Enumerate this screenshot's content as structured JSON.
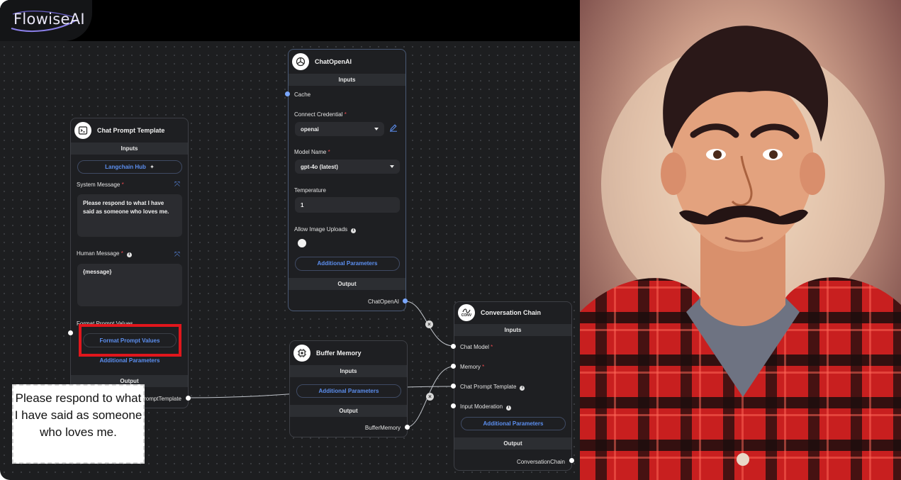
{
  "app": {
    "logo_text": "FlowiseAI"
  },
  "nodes": {
    "chat_prompt": {
      "title": "Chat Prompt Template",
      "inputs_label": "Inputs",
      "hub_button": "Langchain Hub",
      "system_message_label": "System Message",
      "system_message_value": "Please respond to what I have said as someone who loves me.",
      "human_message_label": "Human Message",
      "human_message_value": "{message}",
      "format_label": "Format Prompt Values",
      "format_button": "Format Prompt Values",
      "additional_params": "Additional Parameters",
      "output_label": "Output",
      "output_port": "ChatPromptTemplate"
    },
    "chat_openai": {
      "title": "ChatOpenAI",
      "inputs_label": "Inputs",
      "cache_label": "Cache",
      "credential_label": "Connect Credential",
      "credential_value": "openai",
      "model_label": "Model Name",
      "model_value": "gpt-4o (latest)",
      "temperature_label": "Temperature",
      "temperature_value": "1",
      "image_uploads_label": "Allow Image Uploads",
      "additional_params": "Additional Parameters",
      "output_label": "Output",
      "output_port": "ChatOpenAI"
    },
    "buffer_memory": {
      "title": "Buffer Memory",
      "inputs_label": "Inputs",
      "additional_params": "Additional Parameters",
      "output_label": "Output",
      "output_port": "BufferMemory"
    },
    "conversation_chain": {
      "title": "Conversation Chain",
      "icon_text": "CONV",
      "inputs_label": "Inputs",
      "chat_model_label": "Chat Model",
      "memory_label": "Memory",
      "prompt_label": "Chat Prompt Template",
      "moderation_label": "Input Moderation",
      "additional_params": "Additional Parameters",
      "output_label": "Output",
      "output_port": "ConversationChain"
    }
  },
  "callout": {
    "text": "Please respond to what I have said as someone who loves me."
  },
  "colors": {
    "canvas": "#1d1e20",
    "accent_blue": "#5c8ff0",
    "highlight_red": "#e0161c"
  }
}
